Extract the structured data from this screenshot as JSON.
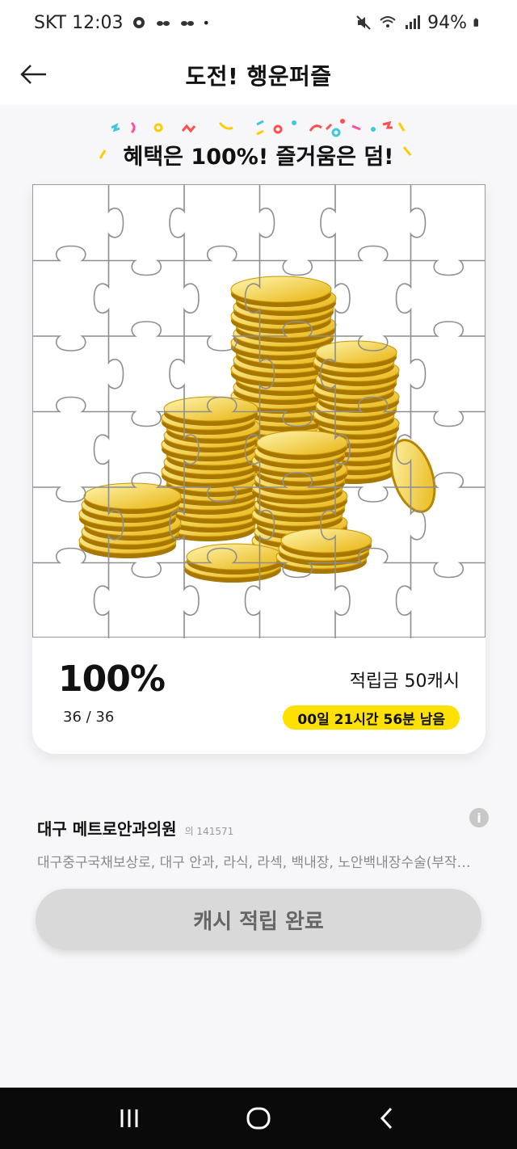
{
  "status_bar": {
    "carrier_time": "SKT 12:03",
    "battery": "94%"
  },
  "header": {
    "title": "도전! 행운퍼즐"
  },
  "banner": {
    "part1": "혜택은 ",
    "part2": "100%!",
    "part3": " 즐거움은 ",
    "part4": "덤!"
  },
  "puzzle": {
    "rows": 6,
    "cols": 6,
    "completed_pieces": 36,
    "total_pieces": 36,
    "image": "gold-coins-stack"
  },
  "progress": {
    "percent": "100%",
    "count": "36 / 36",
    "reward": "적립금 50캐시",
    "timer": "00일 21시간 56분 남음"
  },
  "clinic": {
    "name": "대구 메트로안과의원",
    "reg": "의 141571",
    "desc": "대구중구국채보상로, 대구 안과, 라식, 라섹, 백내장, 노안백내장수술(부작용…"
  },
  "actions": {
    "complete_label": "캐시 적립 완료"
  },
  "colors": {
    "accent": "#ffe100",
    "button_disabled": "#d9d9d9",
    "nav_bg": "#0a0a0a"
  }
}
